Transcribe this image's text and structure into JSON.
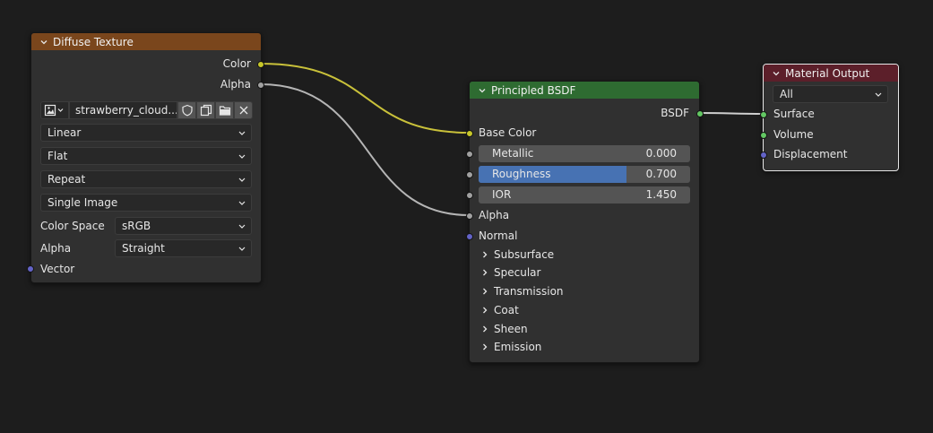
{
  "colors": {
    "background": "#1d1d1d",
    "node_body": "#303030",
    "image_header": "#7a461c",
    "shader_header": "#2e6b31",
    "output_header": "#5c1f2a",
    "socket_color": "#c7c729",
    "socket_float": "#a1a1a1",
    "socket_vector": "#6363c7",
    "socket_shader": "#63c763",
    "slider_fill": "#4772b3",
    "link_color": "#c9c13a",
    "link_float": "#b5b5b5"
  },
  "diffuse_node": {
    "title": "Diffuse Texture",
    "outputs": {
      "color": "Color",
      "alpha": "Alpha"
    },
    "image_name": "strawberry_cloud...",
    "interpolation": "Linear",
    "projection": "Flat",
    "extension": "Repeat",
    "source": "Single Image",
    "color_space_label": "Color Space",
    "color_space_value": "sRGB",
    "alpha_label": "Alpha",
    "alpha_value": "Straight",
    "vector_input": "Vector"
  },
  "bsdf_node": {
    "title": "Principled BSDF",
    "output": "BSDF",
    "base_color": "Base Color",
    "metallic": {
      "label": "Metallic",
      "value": "0.000",
      "fraction": 0.0
    },
    "roughness": {
      "label": "Roughness",
      "value": "0.700",
      "fraction": 0.7
    },
    "ior": {
      "label": "IOR",
      "value": "1.450",
      "fraction": 0.0
    },
    "alpha": "Alpha",
    "normal": "Normal",
    "panels": [
      "Subsurface",
      "Specular",
      "Transmission",
      "Coat",
      "Sheen",
      "Emission"
    ]
  },
  "output_node": {
    "title": "Material Output",
    "target": "All",
    "inputs": {
      "surface": "Surface",
      "volume": "Volume",
      "displacement": "Displacement"
    }
  }
}
